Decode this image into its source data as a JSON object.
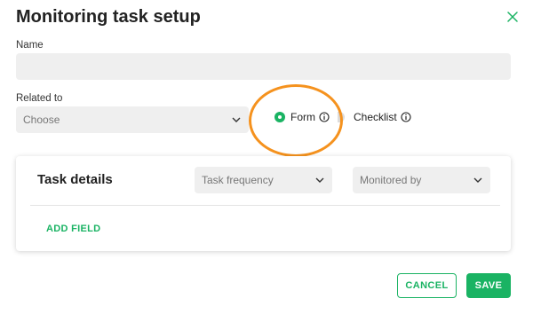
{
  "dialog": {
    "title": "Monitoring task setup"
  },
  "form": {
    "name_label": "Name",
    "name_value": "",
    "related_label": "Related to",
    "related_placeholder": "Choose",
    "options": [
      {
        "label": "Form",
        "selected": true
      },
      {
        "label": "Checklist",
        "selected": false
      }
    ]
  },
  "task_details": {
    "title": "Task details",
    "frequency_placeholder": "Task frequency",
    "monitored_placeholder": "Monitored by",
    "add_field_label": "ADD FIELD"
  },
  "footer": {
    "cancel_label": "CANCEL",
    "save_label": "SAVE"
  },
  "colors": {
    "accent": "#1ab363",
    "highlight": "#f5921e",
    "field_bg": "#efefef"
  },
  "icons": [
    "close-icon",
    "chevron-down-icon",
    "info-icon"
  ]
}
